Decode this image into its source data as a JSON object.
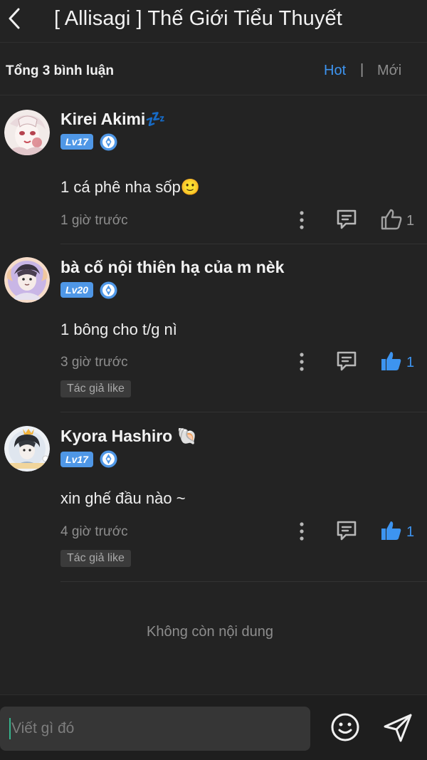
{
  "header": {
    "title": "[ Allisagi ] Thế Giới Tiểu Thuyết"
  },
  "subbar": {
    "total": "Tổng 3 bình luận",
    "sort_hot": "Hot",
    "separator": "|",
    "sort_new": "Mới"
  },
  "comments": [
    {
      "username": "Kirei Akimi💤",
      "level": "Lv17",
      "text": "1 cá phê nha sốp🙂",
      "time": "1 giờ trước",
      "likes": "1",
      "liked": false,
      "author_liked": null
    },
    {
      "username": "bà cố nội thiên hạ của m nèk",
      "level": "Lv20",
      "text": "1 bông cho t/g nì",
      "time": "3 giờ trước",
      "likes": "1",
      "liked": true,
      "author_liked": "Tác giả like"
    },
    {
      "username": "Kyora Hashiro 🐚",
      "level": "Lv17",
      "text": "xin ghế đầu nào ~",
      "time": "4 giờ trước",
      "likes": "1",
      "liked": true,
      "author_liked": "Tác giả like"
    }
  ],
  "footer_note": "Không còn nội dung",
  "composer": {
    "placeholder": "Viết gì đó"
  },
  "colors": {
    "accent": "#3d94f0",
    "background": "#232323",
    "badge": "#4f97e6",
    "liked": "#3d94f0",
    "unliked": "#9a9a9a"
  },
  "icons": {
    "back": "chevron-left-icon",
    "more": "more-vertical-icon",
    "reply": "comment-icon",
    "like": "thumbs-up-icon",
    "verified": "verified-icon",
    "emoji": "emoji-icon",
    "send": "send-icon"
  }
}
